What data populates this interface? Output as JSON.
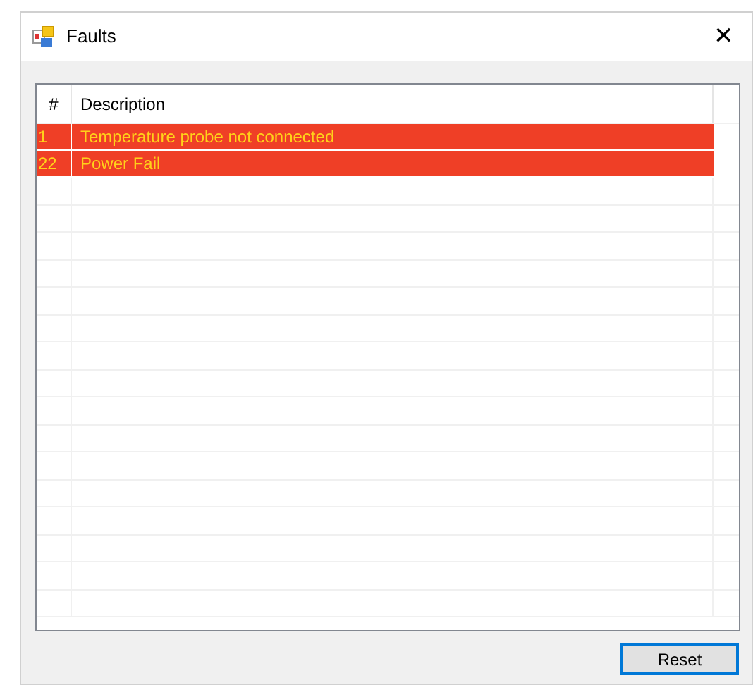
{
  "window": {
    "title": "Faults",
    "close": "✕"
  },
  "table": {
    "columns": [
      "#",
      "Description"
    ],
    "rows": [
      {
        "number": "1",
        "description": "Temperature probe not connected"
      },
      {
        "number": "22",
        "description": "Power Fail"
      }
    ]
  },
  "buttons": [
    {
      "label": "Reset",
      "focused": true
    }
  ]
}
